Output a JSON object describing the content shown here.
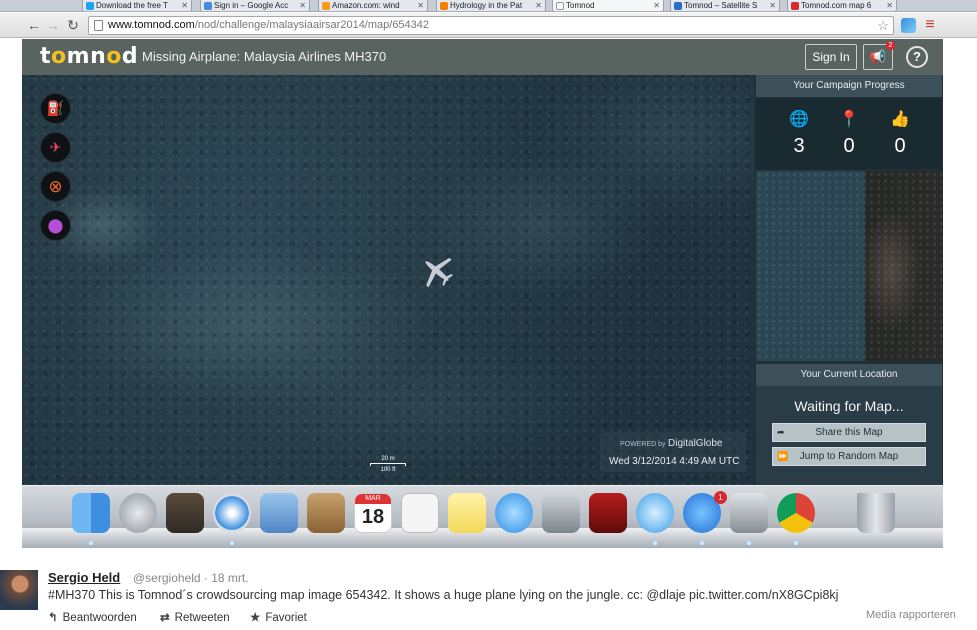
{
  "browser": {
    "tabs": [
      {
        "title": "Download the free T",
        "color": "#1da1f2"
      },
      {
        "title": "Sign in – Google Acc",
        "color": "#4a88e0"
      },
      {
        "title": "Amazon.com: wind",
        "color": "#f59a1a"
      },
      {
        "title": "Hydrology in the Pat",
        "color": "#f57d00"
      },
      {
        "title": "Tomnod",
        "color": "#cccccc"
      },
      {
        "title": "Tomnod – Satellite S",
        "color": "#2a6fc6"
      },
      {
        "title": "Tomnod.com map 6",
        "color": "#d52b2b"
      }
    ],
    "url_host": "www.tomnod.com",
    "url_path": "/nod/challenge/malaysiaairsar2014/map/654342"
  },
  "app": {
    "logo": {
      "t": "t",
      "o1": "o",
      "m": "mn",
      "o2": "o",
      "d": "d"
    },
    "title": "Missing Airplane: Malaysia Airlines MH370",
    "signin_label": "Sign In",
    "notification_count": "2",
    "help_label": "?"
  },
  "map": {
    "scale_top": "20 m",
    "scale_bottom": "100 ft",
    "powered_by": "POWERED by",
    "provider": "DigitalGlobe",
    "capture_date": "Wed 3/12/2014 4:49 AM UTC"
  },
  "panel": {
    "progress_title": "Your Campaign Progress",
    "stats": [
      {
        "icon": "globe-icon",
        "glyph": "🌐",
        "value": "3"
      },
      {
        "icon": "location-pin-icon",
        "glyph": "📍",
        "value": "0"
      },
      {
        "icon": "thumbs-up-icon",
        "glyph": "👍",
        "value": "0"
      }
    ],
    "location_title": "Your Current Location",
    "waiting_text": "Waiting for Map...",
    "share_label": "Share this Map",
    "random_label": "Jump to Random Map"
  },
  "dock": {
    "badge_count": "1",
    "calendar_month": "MAR",
    "calendar_day": "18"
  },
  "tweet": {
    "name": "Sergio Held",
    "handle": "@sergioheld · 18 mrt.",
    "text": "#MH370 This is Tomnod´s crowdsourcing map image 654342. It shows a huge plane lying on the jungle. cc: @dlaje pic.twitter.com/nX8GCpi8kj",
    "reply_label": "Beantwoorden",
    "retweet_label": "Retweeten",
    "favorite_label": "Favoriet",
    "report_label": "Media rapporteren"
  }
}
